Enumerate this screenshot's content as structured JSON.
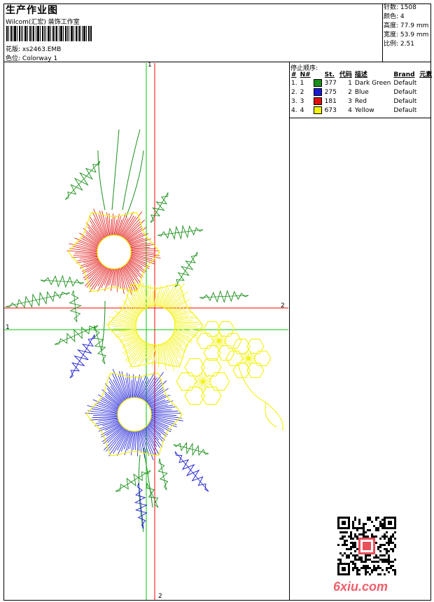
{
  "header": {
    "title": "生产作业图",
    "studio": "Wilcom(汇宏) 装饰工作室",
    "design_label": "花版:",
    "design_value": "xs2463.EMB",
    "colorway_label": "色位:",
    "colorway_value": "Colorway 1"
  },
  "stats": [
    {
      "label": "针数:",
      "value": "1508"
    },
    {
      "label": "颜色:",
      "value": "4"
    },
    {
      "label": "高度:",
      "value": "77.9 mm"
    },
    {
      "label": "宽度:",
      "value": "53.9 mm"
    },
    {
      "label": "比例:",
      "value": "2.51"
    }
  ],
  "stop_sequence": {
    "title": "停止顺序:",
    "headers": [
      "#",
      "N#",
      "St.",
      "代码",
      "描述",
      "Brand",
      "元素"
    ],
    "rows": [
      {
        "idx": "1.",
        "n": "1",
        "color": "#1a8f1a",
        "st": "377",
        "code": "1",
        "desc": "Dark Green",
        "brand": "Default"
      },
      {
        "idx": "2.",
        "n": "2",
        "color": "#1a1ad6",
        "st": "275",
        "code": "2",
        "desc": "Blue",
        "brand": "Default"
      },
      {
        "idx": "3.",
        "n": "3",
        "color": "#e01010",
        "st": "181",
        "code": "3",
        "desc": "Red",
        "brand": "Default"
      },
      {
        "idx": "4.",
        "n": "4",
        "color": "#f2f20a",
        "st": "673",
        "code": "4",
        "desc": "Yellow",
        "brand": "Default"
      }
    ]
  },
  "axes": {
    "v_green": "1",
    "h_red": "2",
    "h_green": "1",
    "v_red": "2"
  },
  "watermark": {
    "site": "6xiu.com"
  },
  "colors": {
    "green_axis": "#00cc00",
    "red_axis": "#ff0000",
    "site": "#f0606a"
  }
}
